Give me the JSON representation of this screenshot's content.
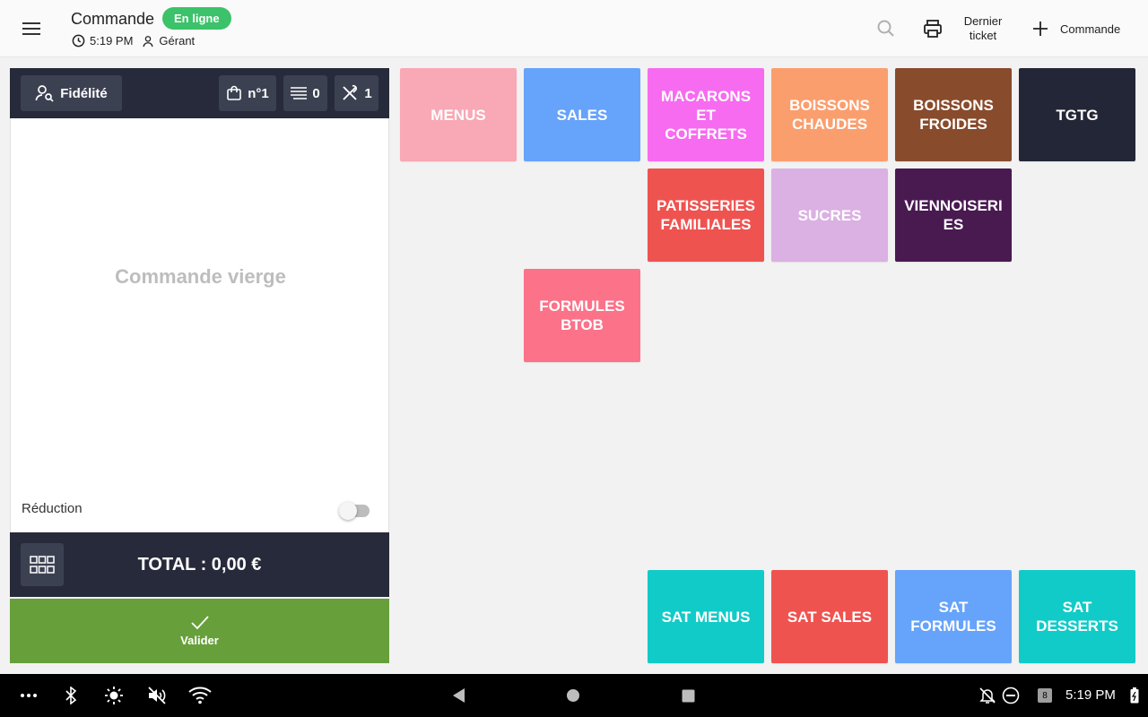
{
  "header": {
    "title": "Commande",
    "status_badge": "En ligne",
    "time": "5:19 PM",
    "user_role": "Gérant",
    "last_ticket_label": "Dernier ticket",
    "new_order_label": "Commande",
    "colors": {
      "badge": "#3cc26a"
    }
  },
  "order_panel": {
    "loyalty_label": "Fidélité",
    "order_number": "n°1",
    "lines_count": "0",
    "covers_count": "1",
    "empty_message": "Commande vierge",
    "discount_label": "Réduction",
    "discount_enabled": false,
    "total_label": "TOTAL : 0,00 €",
    "validate_label": "Valider",
    "colors": {
      "dark": "#262a3a",
      "validate": "#67a03b"
    }
  },
  "categories": [
    {
      "label": "MENUS",
      "color": "#f9a8b5"
    },
    {
      "label": "SALES",
      "color": "#66a3fb"
    },
    {
      "label": "MACARONS ET COFFRETS",
      "color": "#f76bf0"
    },
    {
      "label": "BOISSONS CHAUDES",
      "color": "#fb9e6e"
    },
    {
      "label": "BOISSONS FROIDES",
      "color": "#884b2c"
    },
    {
      "label": "TGTG",
      "color": "#232637"
    },
    {
      "label": "PATISSERIES FAMILIALES",
      "color": "#ef5350"
    },
    {
      "label": "SUCRES",
      "color": "#dbb0e3"
    },
    {
      "label": "VIENNOISERIES",
      "color": "#481a50"
    },
    {
      "label": "FORMULES BTOB",
      "color": "#fb7289"
    },
    {
      "label": "SAT MENUS",
      "color": "#11cbc8"
    },
    {
      "label": "SAT SALES",
      "color": "#ef5350"
    },
    {
      "label": "SAT FORMULES",
      "color": "#66a3fb"
    },
    {
      "label": "SAT DESSERTS",
      "color": "#11cbc8"
    }
  ],
  "system_bar": {
    "time": "5:19 PM",
    "notification_count": "8"
  }
}
